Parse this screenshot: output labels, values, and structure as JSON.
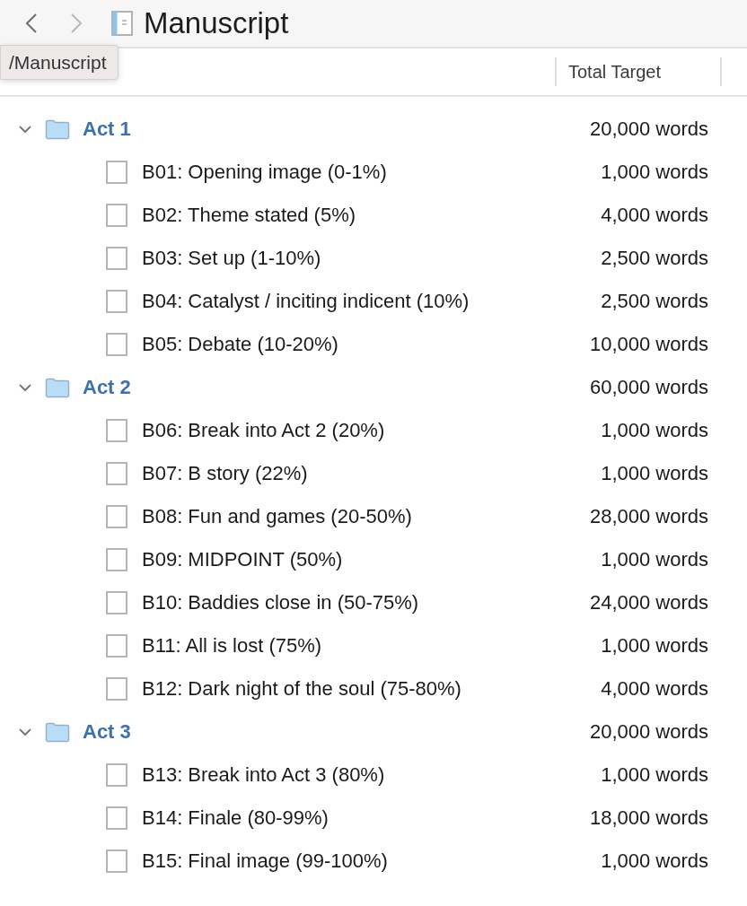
{
  "toolbar": {
    "title": "Manuscript",
    "back_enabled": true,
    "forward_enabled": false
  },
  "tooltip": {
    "text": "/Manuscript"
  },
  "columns": [
    {
      "label": "Total Target"
    }
  ],
  "outline": [
    {
      "title": "Act 1",
      "target": "20,000 words",
      "expanded": true,
      "children": [
        {
          "title": "B01: Opening image (0-1%)",
          "target": "1,000 words"
        },
        {
          "title": "B02: Theme stated (5%)",
          "target": "4,000 words"
        },
        {
          "title": "B03: Set up (1-10%)",
          "target": "2,500 words"
        },
        {
          "title": "B04: Catalyst / inciting indicent (10%)",
          "target": "2,500 words"
        },
        {
          "title": "B05: Debate (10-20%)",
          "target": "10,000 words"
        }
      ]
    },
    {
      "title": "Act 2",
      "target": "60,000 words",
      "expanded": true,
      "children": [
        {
          "title": "B06: Break into Act 2 (20%)",
          "target": "1,000 words"
        },
        {
          "title": "B07: B story (22%)",
          "target": "1,000 words"
        },
        {
          "title": "B08: Fun and games (20-50%)",
          "target": "28,000 words"
        },
        {
          "title": "B09: MIDPOINT (50%)",
          "target": "1,000 words"
        },
        {
          "title": "B10: Baddies close in (50-75%)",
          "target": "24,000 words"
        },
        {
          "title": "B11: All is lost (75%)",
          "target": "1,000 words"
        },
        {
          "title": "B12: Dark night of the soul (75-80%)",
          "target": "4,000 words"
        }
      ]
    },
    {
      "title": "Act 3",
      "target": "20,000 words",
      "expanded": true,
      "children": [
        {
          "title": "B13: Break into Act 3 (80%)",
          "target": "1,000 words"
        },
        {
          "title": "B14: Finale (80-99%)",
          "target": "18,000 words"
        },
        {
          "title": "B15: Final image (99-100%)",
          "target": "1,000 words"
        }
      ]
    }
  ]
}
